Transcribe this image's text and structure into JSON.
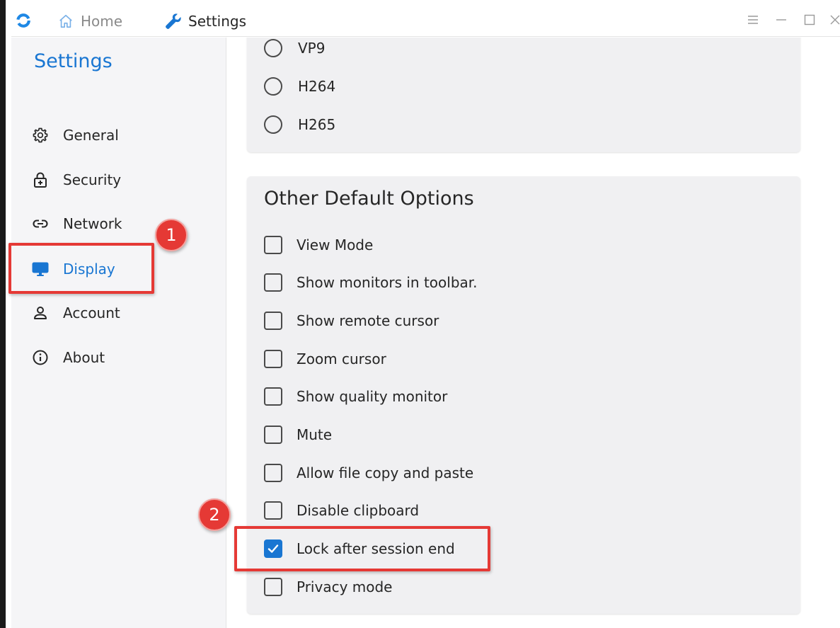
{
  "titlebar": {
    "tabs": [
      {
        "label": "Home",
        "icon": "home-icon"
      },
      {
        "label": "Settings",
        "icon": "wrench-icon"
      }
    ],
    "controls": [
      "menu-icon",
      "minimize-icon",
      "maximize-icon",
      "close-icon"
    ]
  },
  "sidebar": {
    "title": "Settings",
    "items": [
      {
        "label": "General",
        "icon": "gear-icon"
      },
      {
        "label": "Security",
        "icon": "lock-icon"
      },
      {
        "label": "Network",
        "icon": "link-icon"
      },
      {
        "label": "Display",
        "icon": "monitor-icon",
        "active": true
      },
      {
        "label": "Account",
        "icon": "person-icon"
      },
      {
        "label": "About",
        "icon": "info-icon"
      }
    ]
  },
  "codec_card": {
    "options": [
      {
        "label": "VP9",
        "selected": false
      },
      {
        "label": "H264",
        "selected": false
      },
      {
        "label": "H265",
        "selected": false
      }
    ]
  },
  "other_card": {
    "title": "Other Default Options",
    "options": [
      {
        "label": "View Mode",
        "checked": false
      },
      {
        "label": "Show monitors in toolbar.",
        "checked": false
      },
      {
        "label": "Show remote cursor",
        "checked": false
      },
      {
        "label": "Zoom cursor",
        "checked": false
      },
      {
        "label": "Show quality monitor",
        "checked": false
      },
      {
        "label": "Mute",
        "checked": false
      },
      {
        "label": "Allow file copy and paste",
        "checked": false
      },
      {
        "label": "Disable clipboard",
        "checked": false
      },
      {
        "label": "Lock after session end",
        "checked": true
      },
      {
        "label": "Privacy mode",
        "checked": false
      }
    ]
  },
  "annotations": [
    {
      "number": "1",
      "target": "Display"
    },
    {
      "number": "2",
      "target": "Lock after session end"
    }
  ],
  "colors": {
    "accent": "#1976d2",
    "annotation": "#e53935",
    "sidebar_bg": "#f5f5f7",
    "card_bg": "#f0f0f2"
  }
}
